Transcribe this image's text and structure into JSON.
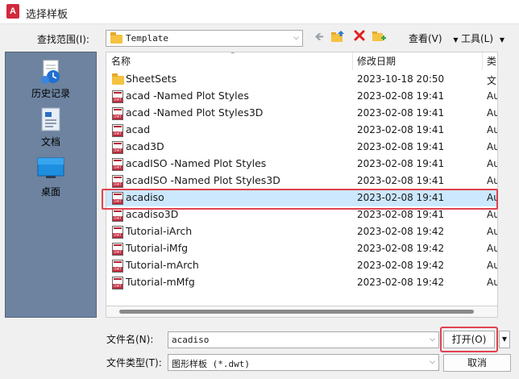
{
  "window": {
    "title": "选择样板",
    "app_icon_letter": "A"
  },
  "lookin": {
    "label": "查找范围(I):",
    "value": "Template"
  },
  "toolbar": {
    "view_label": "查看(V)",
    "tools_label": "工具(L)"
  },
  "places": [
    {
      "label": "历史记录"
    },
    {
      "label": "文档"
    },
    {
      "label": "桌面"
    }
  ],
  "columns": {
    "name": "名称",
    "date": "修改日期",
    "type": "类"
  },
  "files": [
    {
      "name": "SheetSets",
      "date": "2023-10-18 20:50",
      "type": "文",
      "kind": "folder"
    },
    {
      "name": "acad -Named Plot Styles",
      "date": "2023-02-08 19:41",
      "type": "Au",
      "kind": "dwt"
    },
    {
      "name": "acad -Named Plot Styles3D",
      "date": "2023-02-08 19:41",
      "type": "Au",
      "kind": "dwt"
    },
    {
      "name": "acad",
      "date": "2023-02-08 19:41",
      "type": "Au",
      "kind": "dwt"
    },
    {
      "name": "acad3D",
      "date": "2023-02-08 19:41",
      "type": "Au",
      "kind": "dwt"
    },
    {
      "name": "acadISO -Named Plot Styles",
      "date": "2023-02-08 19:41",
      "type": "Au",
      "kind": "dwt"
    },
    {
      "name": "acadISO -Named Plot Styles3D",
      "date": "2023-02-08 19:41",
      "type": "Au",
      "kind": "dwt"
    },
    {
      "name": "acadiso",
      "date": "2023-02-08 19:41",
      "type": "Au",
      "kind": "dwt",
      "selected": true
    },
    {
      "name": "acadiso3D",
      "date": "2023-02-08 19:41",
      "type": "Au",
      "kind": "dwt"
    },
    {
      "name": "Tutorial-iArch",
      "date": "2023-02-08 19:42",
      "type": "Au",
      "kind": "dwt"
    },
    {
      "name": "Tutorial-iMfg",
      "date": "2023-02-08 19:42",
      "type": "Au",
      "kind": "dwt"
    },
    {
      "name": "Tutorial-mArch",
      "date": "2023-02-08 19:42",
      "type": "Au",
      "kind": "dwt"
    },
    {
      "name": "Tutorial-mMfg",
      "date": "2023-02-08 19:42",
      "type": "Au",
      "kind": "dwt"
    }
  ],
  "filename": {
    "label": "文件名(N):",
    "value": "acadiso"
  },
  "filetype": {
    "label": "文件类型(T):",
    "value": "图形样板 (*.dwt)"
  },
  "buttons": {
    "open": "打开(O)",
    "cancel": "取消"
  },
  "colors": {
    "highlight": "#e0424f",
    "selection": "#cce8ff",
    "places_bg": "#6d83a0"
  }
}
